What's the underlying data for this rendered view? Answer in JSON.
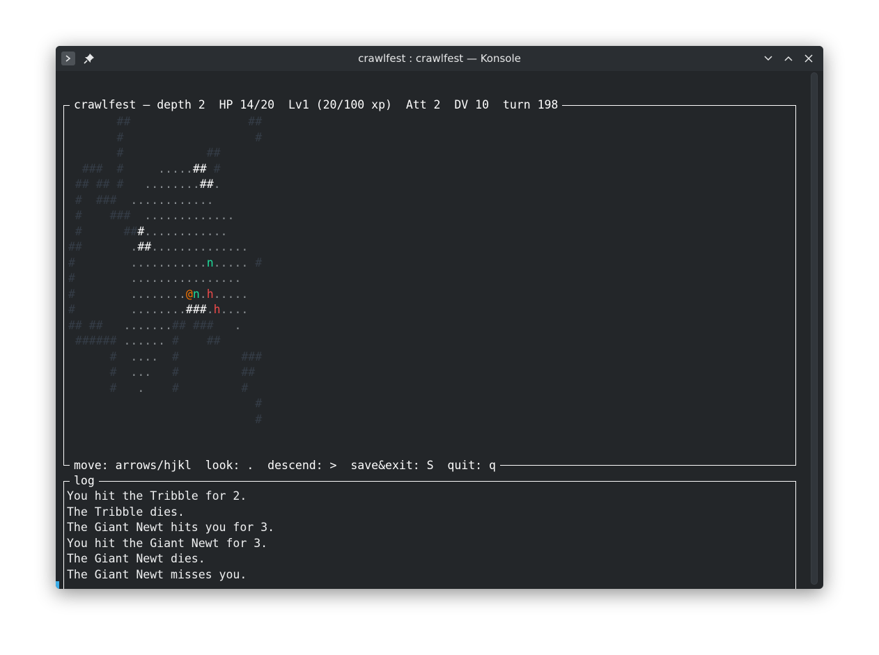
{
  "window": {
    "title": "crawlfest : crawlfest — Konsole",
    "icons": [
      "terminal-app-icon",
      "pin-icon",
      "minimize-icon",
      "maximize-icon",
      "close-icon"
    ]
  },
  "status": {
    "line": "crawlfest — depth 2  HP 14/20  Lv1 (20/100 xp)  Att 2  DV 10  turn 198"
  },
  "help": {
    "line": "move: arrows/hjkl  look: .  descend: >  save&exit: S  quit: q"
  },
  "log": {
    "title": "log",
    "lines": [
      "You hit the Tribble for 2.",
      "The Tribble dies.",
      "The Giant Newt hits you for 3.",
      "You hit the Giant Newt for 3.",
      "The Giant Newt dies.",
      "The Giant Newt misses you."
    ]
  },
  "map": {
    "legend": {
      "player": "@",
      "newt": "n",
      "hostile": "h",
      "wall": "#",
      "floor": "."
    },
    "rows": [
      [
        [
          "dim",
          "       ##                 ##"
        ]
      ],
      [
        [
          "dim",
          "       #                   #"
        ]
      ],
      [
        [
          "dim",
          "       #            ##"
        ]
      ],
      [
        [
          "dim",
          "  ###  #     "
        ],
        [
          "floor",
          "....."
        ],
        [
          "wall",
          "##"
        ],
        [
          "dim",
          " #"
        ]
      ],
      [
        [
          "dim",
          " ## ## #   "
        ],
        [
          "floor",
          "........"
        ],
        [
          "wall",
          "##"
        ],
        [
          "floor",
          "."
        ]
      ],
      [
        [
          "dim",
          " #  ###  "
        ],
        [
          "floor",
          "............"
        ]
      ],
      [
        [
          "dim",
          " #    ###  "
        ],
        [
          "floor",
          "............."
        ]
      ],
      [
        [
          "dim",
          " #      ##"
        ],
        [
          "wall",
          "#"
        ],
        [
          "floor",
          "............"
        ]
      ],
      [
        [
          "dim",
          "##       "
        ],
        [
          "floor",
          "."
        ],
        [
          "wall",
          "##"
        ],
        [
          "floor",
          ".............."
        ]
      ],
      [
        [
          "dim",
          "#        "
        ],
        [
          "floor",
          "..........."
        ],
        [
          "newt",
          "n"
        ],
        [
          "floor",
          "....."
        ],
        [
          "dim",
          " #"
        ]
      ],
      [
        [
          "dim",
          "#        "
        ],
        [
          "floor",
          "................"
        ]
      ],
      [
        [
          "dim",
          "#        "
        ],
        [
          "floor",
          "........"
        ],
        [
          "player",
          "@"
        ],
        [
          "newt",
          "n"
        ],
        [
          "floor",
          "."
        ],
        [
          "hostile",
          "h"
        ],
        [
          "floor",
          "....."
        ]
      ],
      [
        [
          "dim",
          "#        "
        ],
        [
          "floor",
          "........"
        ],
        [
          "wall",
          "###"
        ],
        [
          "floor",
          "."
        ],
        [
          "hostile",
          "h"
        ],
        [
          "floor",
          "...."
        ]
      ],
      [
        [
          "dim",
          "## ##   "
        ],
        [
          "floor",
          "......."
        ],
        [
          "dim",
          "## ###  "
        ],
        [
          "floor",
          " ."
        ]
      ],
      [
        [
          "dim",
          " ###### "
        ],
        [
          "floor",
          "......"
        ],
        [
          "dim",
          " #    ##"
        ]
      ],
      [
        [
          "dim",
          "      #  "
        ],
        [
          "floor",
          "...."
        ],
        [
          "dim",
          "  #         ###"
        ]
      ],
      [
        [
          "dim",
          "      #  "
        ],
        [
          "floor",
          "..."
        ],
        [
          "dim",
          "   #         ##"
        ]
      ],
      [
        [
          "dim",
          "      #   "
        ],
        [
          "floor",
          "."
        ],
        [
          "dim",
          "    #         #"
        ]
      ],
      [
        [
          "dim",
          "                           #"
        ]
      ],
      [
        [
          "dim",
          "                           #"
        ]
      ]
    ]
  }
}
